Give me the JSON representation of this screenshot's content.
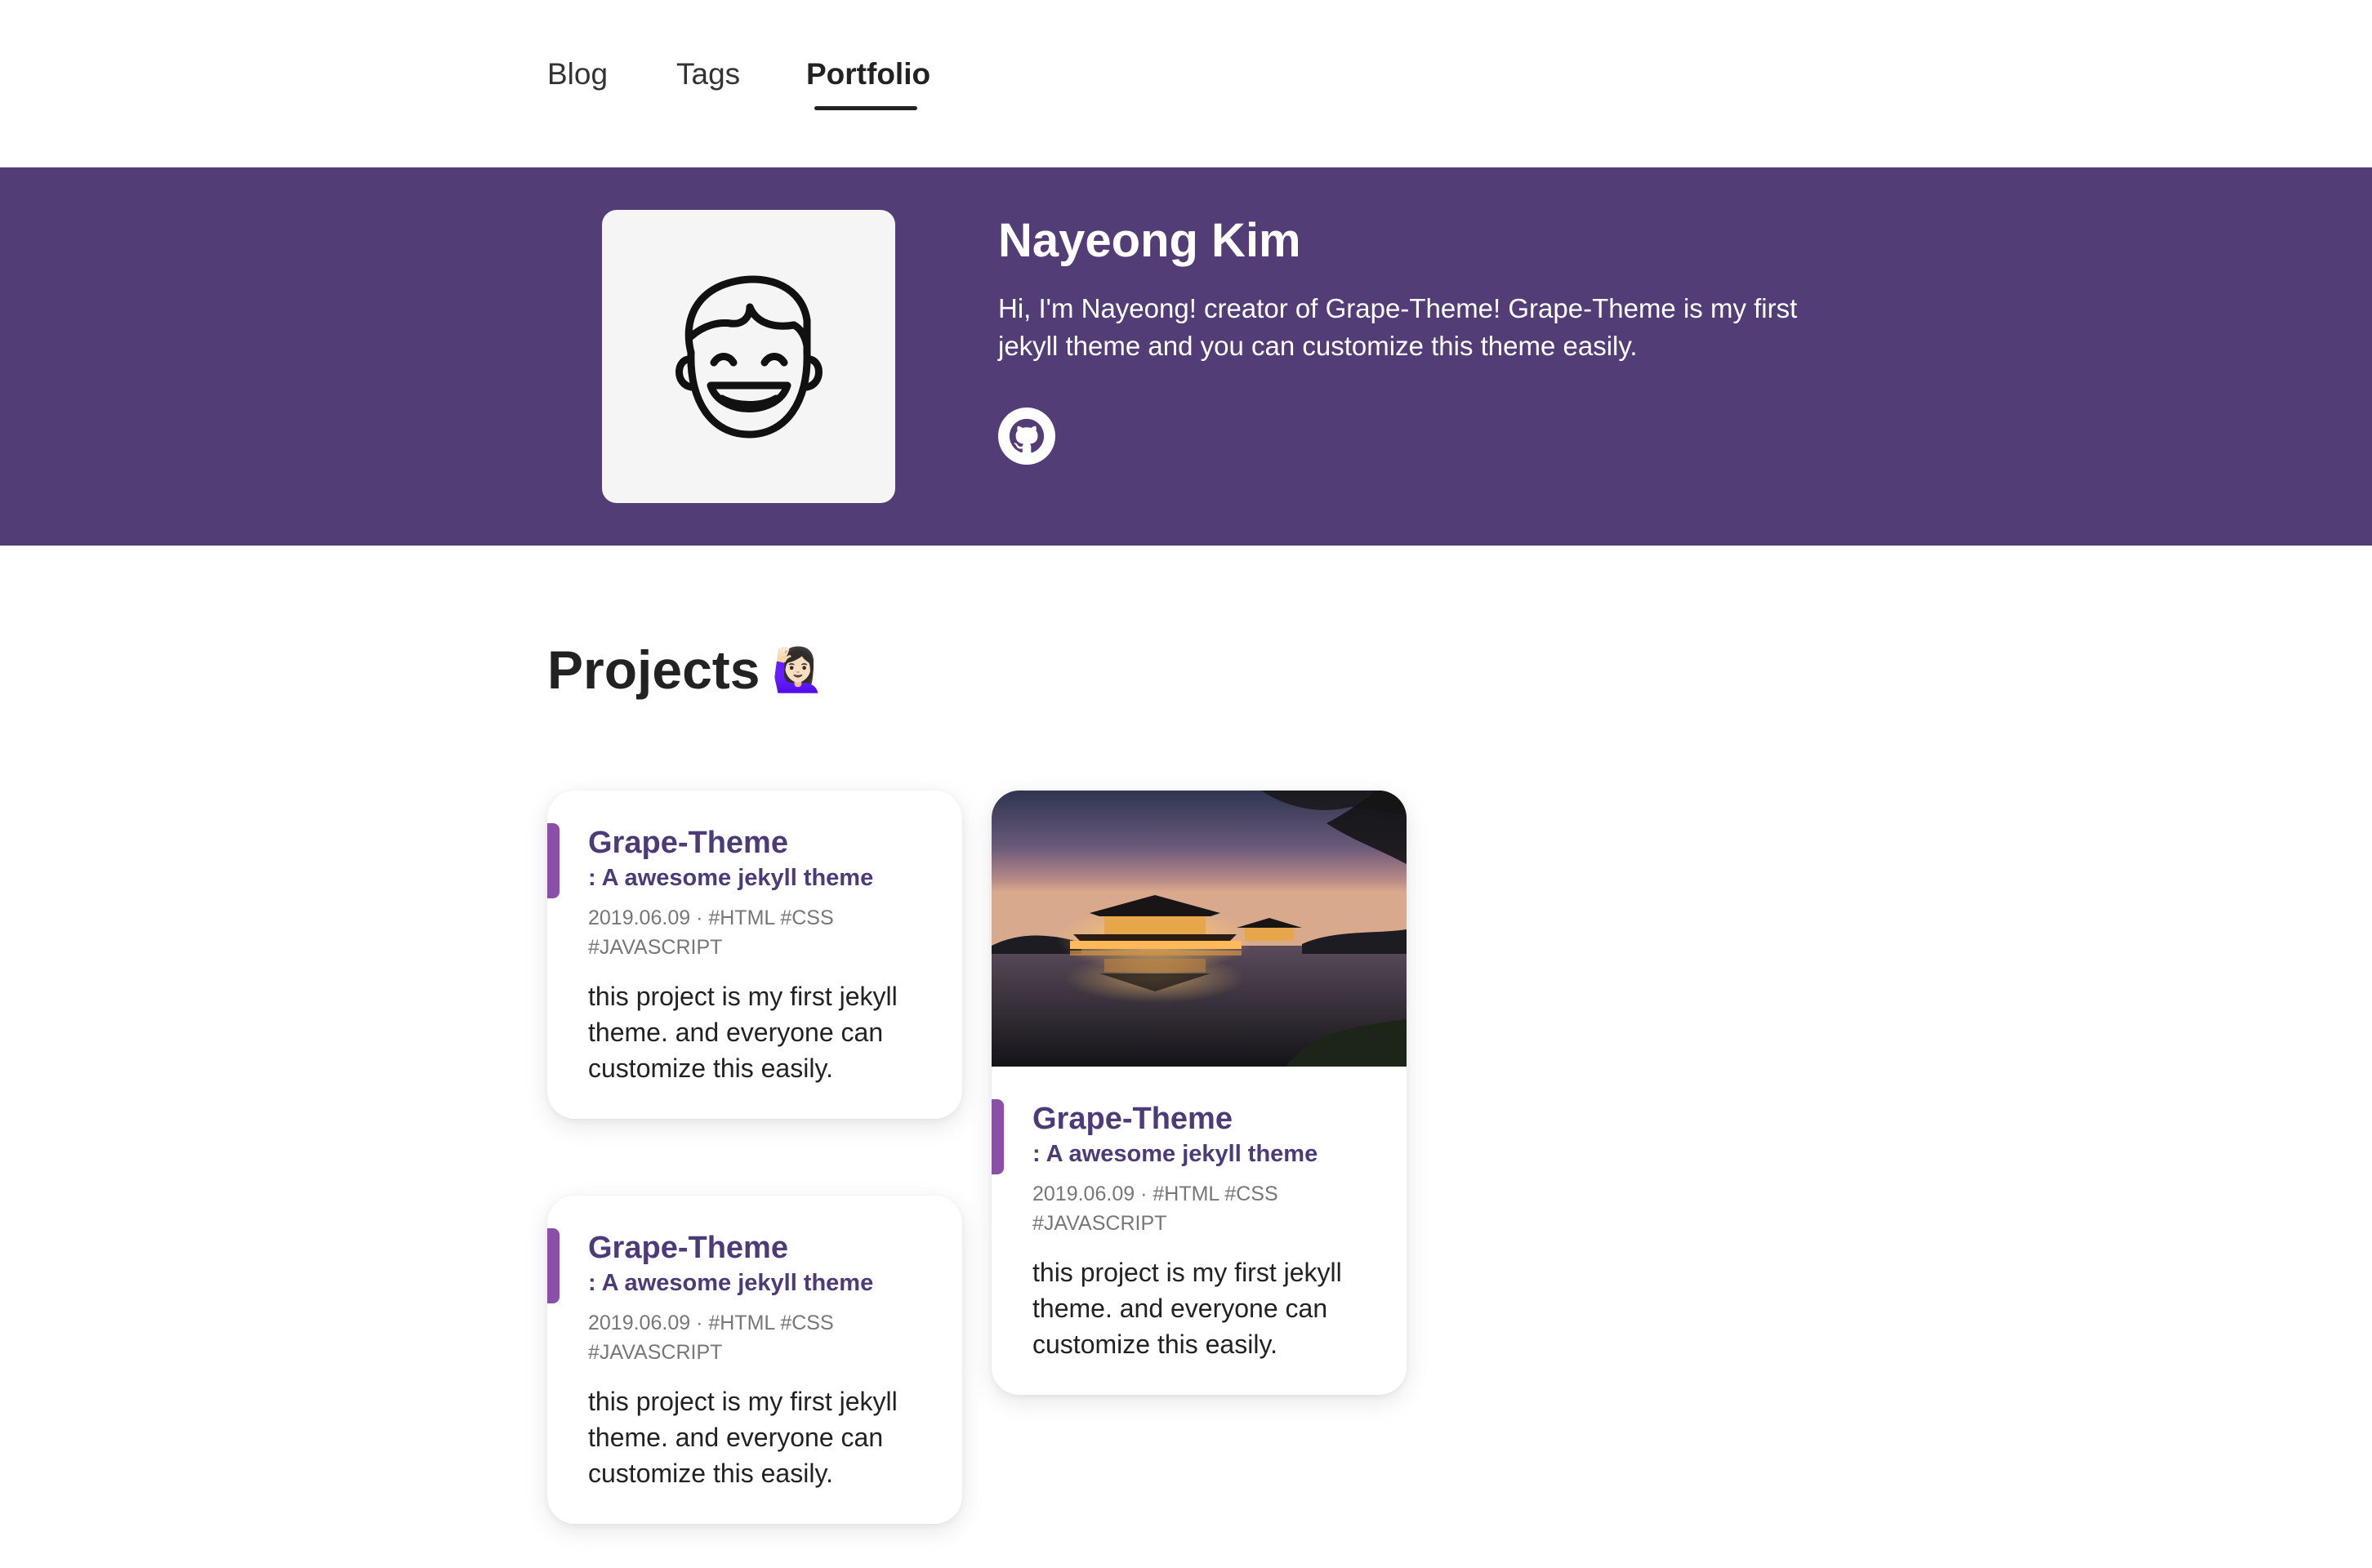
{
  "nav": {
    "items": [
      {
        "label": "Blog"
      },
      {
        "label": "Tags"
      },
      {
        "label": "Portfolio"
      }
    ]
  },
  "hero": {
    "name": "Nayeong Kim",
    "bio": "Hi, I'm Nayeong! creator of Grape-Theme! Grape-Theme is my first jekyll theme and you can customize this theme easily.",
    "github_icon": "github-icon",
    "avatar_icon": "laughing-face-icon"
  },
  "projects": {
    "title": "Projects",
    "emoji": "🙋🏻‍♀️",
    "cards": [
      {
        "title": "Grape-Theme",
        "subtitle": ": A awesome jekyll theme",
        "meta": "2019.06.09 · #HTML #CSS #JAVASCRIPT",
        "description": "this project is my first jekyll theme. and everyone can customize this easily."
      },
      {
        "title": "Grape-Theme",
        "subtitle": ": A awesome jekyll theme",
        "meta": "2019.06.09 · #HTML #CSS #JAVASCRIPT",
        "description": "this project is my first jekyll theme. and everyone can customize this easily."
      },
      {
        "title": "Grape-Theme",
        "subtitle": ": A awesome jekyll theme",
        "meta": "2019.06.09 · #HTML #CSS #JAVASCRIPT",
        "description": "this project is my first jekyll theme. and everyone can customize this easily."
      }
    ]
  },
  "colors": {
    "brand_purple": "#523d77",
    "accent_purple": "#8a4fa6",
    "title_purple": "#4d3a78"
  }
}
